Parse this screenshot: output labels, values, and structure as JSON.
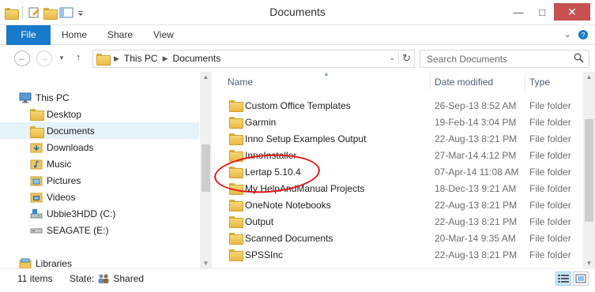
{
  "window": {
    "title": "Documents"
  },
  "ribbon": {
    "tabs": [
      "File",
      "Home",
      "Share",
      "View"
    ]
  },
  "address": {
    "crumbs": [
      "This PC",
      "Documents"
    ],
    "search_placeholder": "Search Documents"
  },
  "nav": {
    "items": [
      {
        "label": "This PC",
        "icon": "computer-icon",
        "indent": 0
      },
      {
        "label": "Desktop",
        "icon": "folder-icon",
        "indent": 1
      },
      {
        "label": "Documents",
        "icon": "folder-icon",
        "indent": 1,
        "selected": true
      },
      {
        "label": "Downloads",
        "icon": "downloads-folder-icon",
        "indent": 1
      },
      {
        "label": "Music",
        "icon": "music-folder-icon",
        "indent": 1
      },
      {
        "label": "Pictures",
        "icon": "pictures-folder-icon",
        "indent": 1
      },
      {
        "label": "Videos",
        "icon": "videos-folder-icon",
        "indent": 1
      },
      {
        "label": "Ubbie3HDD (C:)",
        "icon": "drive-icon",
        "indent": 1
      },
      {
        "label": "SEAGATE (E:)",
        "icon": "removable-drive-icon",
        "indent": 1
      },
      {
        "label": "Libraries",
        "icon": "libraries-icon",
        "indent": 0,
        "gap": true
      }
    ]
  },
  "columns": {
    "name": "Name",
    "date": "Date modified",
    "type": "Type"
  },
  "files": [
    {
      "name": "Custom Office Templates",
      "date": "26-Sep-13 8:52 AM",
      "type": "File folder"
    },
    {
      "name": "Garmin",
      "date": "19-Feb-14 3:04 PM",
      "type": "File folder"
    },
    {
      "name": "Inno Setup Examples Output",
      "date": "22-Aug-13 8:21 PM",
      "type": "File folder"
    },
    {
      "name": "InnoInstaller",
      "date": "27-Mar-14 4:12 PM",
      "type": "File folder"
    },
    {
      "name": "Lertap 5.10.4",
      "date": "07-Apr-14 11:08 AM",
      "type": "File folder",
      "highlighted": true
    },
    {
      "name": "My HelpAndManual Projects",
      "date": "18-Dec-13 9:21 AM",
      "type": "File folder"
    },
    {
      "name": "OneNote Notebooks",
      "date": "22-Aug-13 8:21 PM",
      "type": "File folder"
    },
    {
      "name": "Output",
      "date": "22-Aug-13 8:21 PM",
      "type": "File folder"
    },
    {
      "name": "Scanned Documents",
      "date": "20-Mar-14 9:35 AM",
      "type": "File folder"
    },
    {
      "name": "SPSSInc",
      "date": "22-Aug-13 8:21 PM",
      "type": "File folder"
    }
  ],
  "status": {
    "count": "11 items",
    "state_label": "State:",
    "state_value": "Shared"
  },
  "colors": {
    "accent": "#1979ca",
    "highlight_ring": "#e01818",
    "selection": "#e5f3fb"
  }
}
